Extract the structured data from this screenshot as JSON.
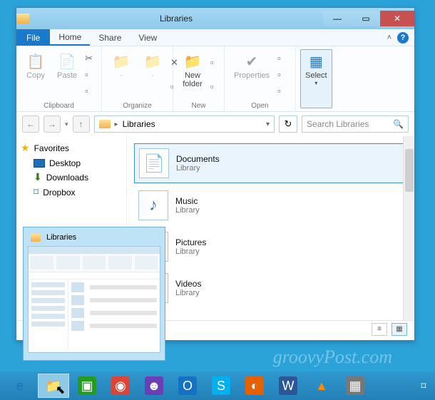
{
  "window": {
    "title": "Libraries",
    "min": "—",
    "max": "▭",
    "close": "✕",
    "caret": "˄"
  },
  "menu": {
    "file": "File",
    "tabs": [
      "Home",
      "Share",
      "View"
    ]
  },
  "ribbon": {
    "clipboard": {
      "copy": "Copy",
      "paste": "Paste",
      "label": "Clipboard"
    },
    "organize": {
      "label": "Organize"
    },
    "new": {
      "newfolder": "New\nfolder",
      "label": "New"
    },
    "open": {
      "properties": "Properties",
      "label": "Open"
    },
    "select": {
      "select": "Select",
      "label": ""
    }
  },
  "address": {
    "back": "←",
    "fwd": "→",
    "up": "↑",
    "path_label": "Libraries",
    "dropdown": "▾",
    "refresh": "↻",
    "search_placeholder": "Search Libraries",
    "search_icon": "🔍"
  },
  "nav": {
    "favorites": "Favorites",
    "items": [
      {
        "label": "Desktop"
      },
      {
        "label": "Downloads"
      },
      {
        "label": "Dropbox"
      }
    ]
  },
  "libraries": {
    "subtype": "Library",
    "items": [
      {
        "name": "Documents",
        "icon": "📄",
        "selected": true
      },
      {
        "name": "Music",
        "icon": "♪"
      },
      {
        "name": "Pictures",
        "icon": "▦"
      },
      {
        "name": "Videos",
        "icon": "►"
      }
    ]
  },
  "thumb": {
    "title": "Libraries"
  },
  "taskbar": {
    "items": [
      {
        "name": "ie",
        "glyph": "e",
        "color": "#1e6fb8",
        "bg": ""
      },
      {
        "name": "explorer",
        "glyph": "📁",
        "color": "",
        "bg": "",
        "active": true
      },
      {
        "name": "store",
        "glyph": "▣",
        "color": "#fff",
        "bg": "#259b24"
      },
      {
        "name": "chrome",
        "glyph": "◉",
        "color": "#fff",
        "bg": "#db4437"
      },
      {
        "name": "app1",
        "glyph": "☻",
        "color": "#fff",
        "bg": "#6a3fb5"
      },
      {
        "name": "outlook",
        "glyph": "O",
        "color": "#fff",
        "bg": "#1571c6"
      },
      {
        "name": "skype",
        "glyph": "S",
        "color": "#fff",
        "bg": "#00aff0"
      },
      {
        "name": "firefox",
        "glyph": "◐",
        "color": "#fff",
        "bg": "#e66000"
      },
      {
        "name": "word",
        "glyph": "W",
        "color": "#fff",
        "bg": "#2b579a"
      },
      {
        "name": "vlc",
        "glyph": "▲",
        "color": "#ff8c00",
        "bg": ""
      },
      {
        "name": "app2",
        "glyph": "▦",
        "color": "#fff",
        "bg": "#777"
      }
    ]
  },
  "watermark": "groovyPost.com"
}
